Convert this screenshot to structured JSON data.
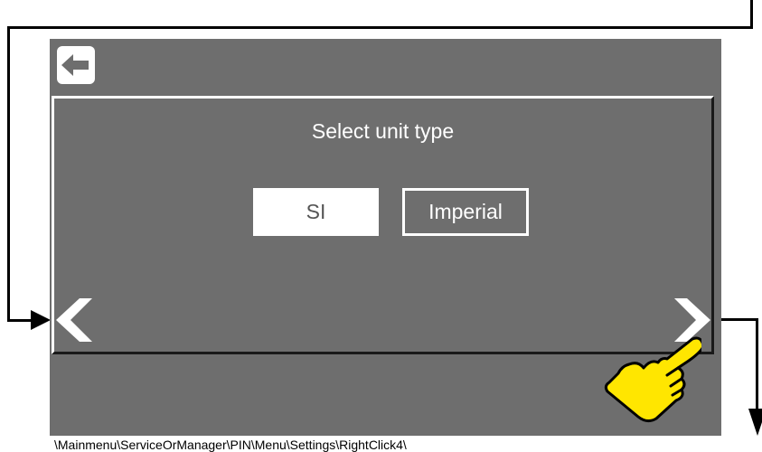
{
  "screen": {
    "back_icon": "arrow-left-icon",
    "panel_title": "Select unit type",
    "options": {
      "si": "SI",
      "imperial": "Imperial"
    },
    "selected_option": "SI",
    "prev_icon": "chevron-left-icon",
    "next_icon": "chevron-right-icon"
  },
  "annotation": {
    "pointer_icon": "pointing-hand-icon",
    "caption": "\\Mainmenu\\ServiceOrManager\\PIN\\Menu\\Settings\\RightClick4\\"
  },
  "colors": {
    "screen_bg": "#6e6e6e",
    "pointer_fill": "#ffe600"
  }
}
